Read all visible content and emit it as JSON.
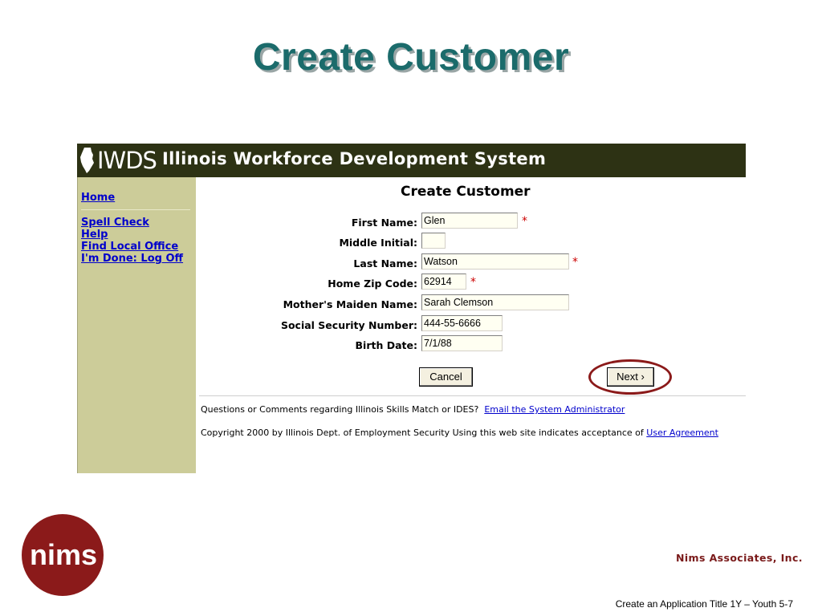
{
  "slide": {
    "title": "Create Customer",
    "company": "Nims Associates, Inc.",
    "footer": "Create an Application Title 1Y – Youth  5-7",
    "logo_text": "nims",
    "colors": {
      "title": "#1b6b6b",
      "logo": "#8b1a1a",
      "ring": "#8b1a1a"
    }
  },
  "app": {
    "logo_mark": "IWDS",
    "header_title": "Illinois Workforce Development System",
    "sidebar": {
      "home": "Home",
      "spell_check": "Spell Check",
      "help": "Help",
      "find_local_office": "Find Local Office",
      "log_off": "I'm Done: Log Off"
    },
    "form": {
      "title": "Create Customer",
      "first_name": {
        "label": "First Name:",
        "value": "Glen",
        "required": "*"
      },
      "middle_initial": {
        "label": "Middle Initial:",
        "value": ""
      },
      "last_name": {
        "label": "Last Name:",
        "value": "Watson",
        "required": "*"
      },
      "home_zip": {
        "label": "Home Zip Code:",
        "value": "62914",
        "required": "*"
      },
      "maiden_name": {
        "label": "Mother's Maiden Name:",
        "value": "Sarah Clemson"
      },
      "ssn": {
        "label": "Social Security Number:",
        "value": "444-55-6666"
      },
      "birth_date": {
        "label": "Birth Date:",
        "value": "7/1/88"
      },
      "cancel_label": "Cancel",
      "next_label": "Next ›"
    },
    "footer": {
      "questions": "Questions or Comments regarding Illinois Skills Match or IDES?",
      "email_link": "Email the System Administrator",
      "copyright": "Copyright 2000 by Illinois Dept. of Employment Security Using this web site indicates acceptance of",
      "agreement_link": "User Agreement"
    },
    "colors": {
      "header": "#2d3214",
      "sidebar": "#cccc99",
      "link": "#0000cc",
      "required": "#cc0000"
    }
  }
}
